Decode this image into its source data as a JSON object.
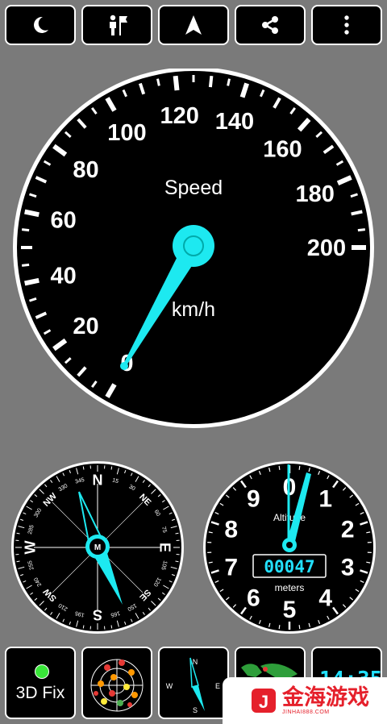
{
  "toolbar": {
    "buttons": [
      {
        "icon": "moon-icon"
      },
      {
        "icon": "person-flag-icon"
      },
      {
        "icon": "navigation-arrow-icon"
      },
      {
        "icon": "share-icon"
      },
      {
        "icon": "more-vertical-icon"
      }
    ]
  },
  "speedometer": {
    "label": "Speed",
    "unit": "km/h",
    "ticks": [
      "0",
      "20",
      "40",
      "60",
      "80",
      "100",
      "120",
      "140",
      "160",
      "180",
      "200"
    ],
    "value": 0,
    "max": 200,
    "needle_color": "#1de9f0"
  },
  "compass": {
    "cardinals": [
      "N",
      "E",
      "S",
      "W"
    ],
    "intercardinals": [
      "NE",
      "SE",
      "SW",
      "NW"
    ],
    "degrees": [
      "15",
      "30",
      "60",
      "75",
      "105",
      "120",
      "150",
      "165",
      "195",
      "210",
      "240",
      "255",
      "285",
      "300",
      "330",
      "345"
    ],
    "center_label": "M",
    "heading_deg": 345
  },
  "altimeter": {
    "label": "Altitude",
    "digits": [
      "0",
      "1",
      "2",
      "3",
      "4",
      "5",
      "6",
      "7",
      "8",
      "9"
    ],
    "reading": "00047",
    "unit": "meters",
    "value_m": 47,
    "accent": "#22e0ff"
  },
  "bottombar": {
    "fix_label": "3D Fix",
    "fix_color": "#39e639",
    "mini_compass_letters": [
      "N",
      "E",
      "S",
      "W"
    ],
    "clock": "14:35"
  },
  "watermark": {
    "brand": "金海游戏",
    "url": "JINHAI888.COM",
    "logo_letter": "J"
  }
}
